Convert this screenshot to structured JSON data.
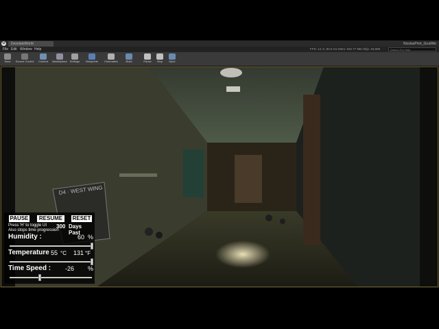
{
  "window": {
    "tab_label": "DesolateWorld",
    "user_label": "NicolasPirot_GrudWe",
    "menu": [
      "File",
      "Edit",
      "Window",
      "Help"
    ],
    "stats": "FPS: 12.4 | 80.6 ms  Mem: 832.77 MB  Objs: 46,808",
    "search_placeholder": "Search For Help"
  },
  "toolbar": {
    "items": [
      {
        "label": "Save",
        "icon": "save-icon",
        "color": "#8a8a8a"
      },
      {
        "label": "Source Control",
        "icon": "source-control-icon",
        "color": "#777"
      },
      {
        "label": "Content",
        "icon": "content-icon",
        "color": "#6f8fb0"
      },
      {
        "label": "Marketplace",
        "icon": "marketplace-icon",
        "color": "#9090a0"
      },
      {
        "label": "Settings",
        "icon": "settings-icon",
        "color": "#a0a0a0"
      },
      {
        "label": "Blueprints",
        "icon": "blueprints-icon",
        "color": "#5a7fb5"
      },
      {
        "label": "Cinematics",
        "icon": "cinematics-icon",
        "color": "#b0b0b0"
      },
      {
        "label": "Build",
        "icon": "build-icon",
        "color": "#6a8ab0"
      },
      {
        "label": "Pause",
        "icon": "pause-icon",
        "color": "#c0c0c0"
      },
      {
        "label": "Stop",
        "icon": "stop-icon",
        "color": "#c0c0c0"
      },
      {
        "label": "Eject",
        "icon": "eject-icon",
        "color": "#6a8ab0"
      }
    ]
  },
  "scene": {
    "sign_text": "D4 · WEST WING"
  },
  "hud": {
    "pause_label": "PAUSE",
    "resume_label": "RESUME",
    "reset_label": "RESET",
    "help_line1": "Press 'H' to toggle UI",
    "help_line2": "Also stops time progression",
    "days_value": "300",
    "days_label": "Days Past",
    "humidity_label": "Humidity :",
    "humidity_value": "60",
    "humidity_unit": "%",
    "humidity_fraction": 1.0,
    "temperature_label": "Temperature",
    "temp_c": "55",
    "temp_c_unit": "°C",
    "temp_f": "131",
    "temp_f_unit": "°F",
    "temperature_fraction": 1.0,
    "timespeed_label": "Time Speed :",
    "timespeed_value": "-26",
    "timespeed_unit": "%",
    "timespeed_fraction": 0.37
  }
}
